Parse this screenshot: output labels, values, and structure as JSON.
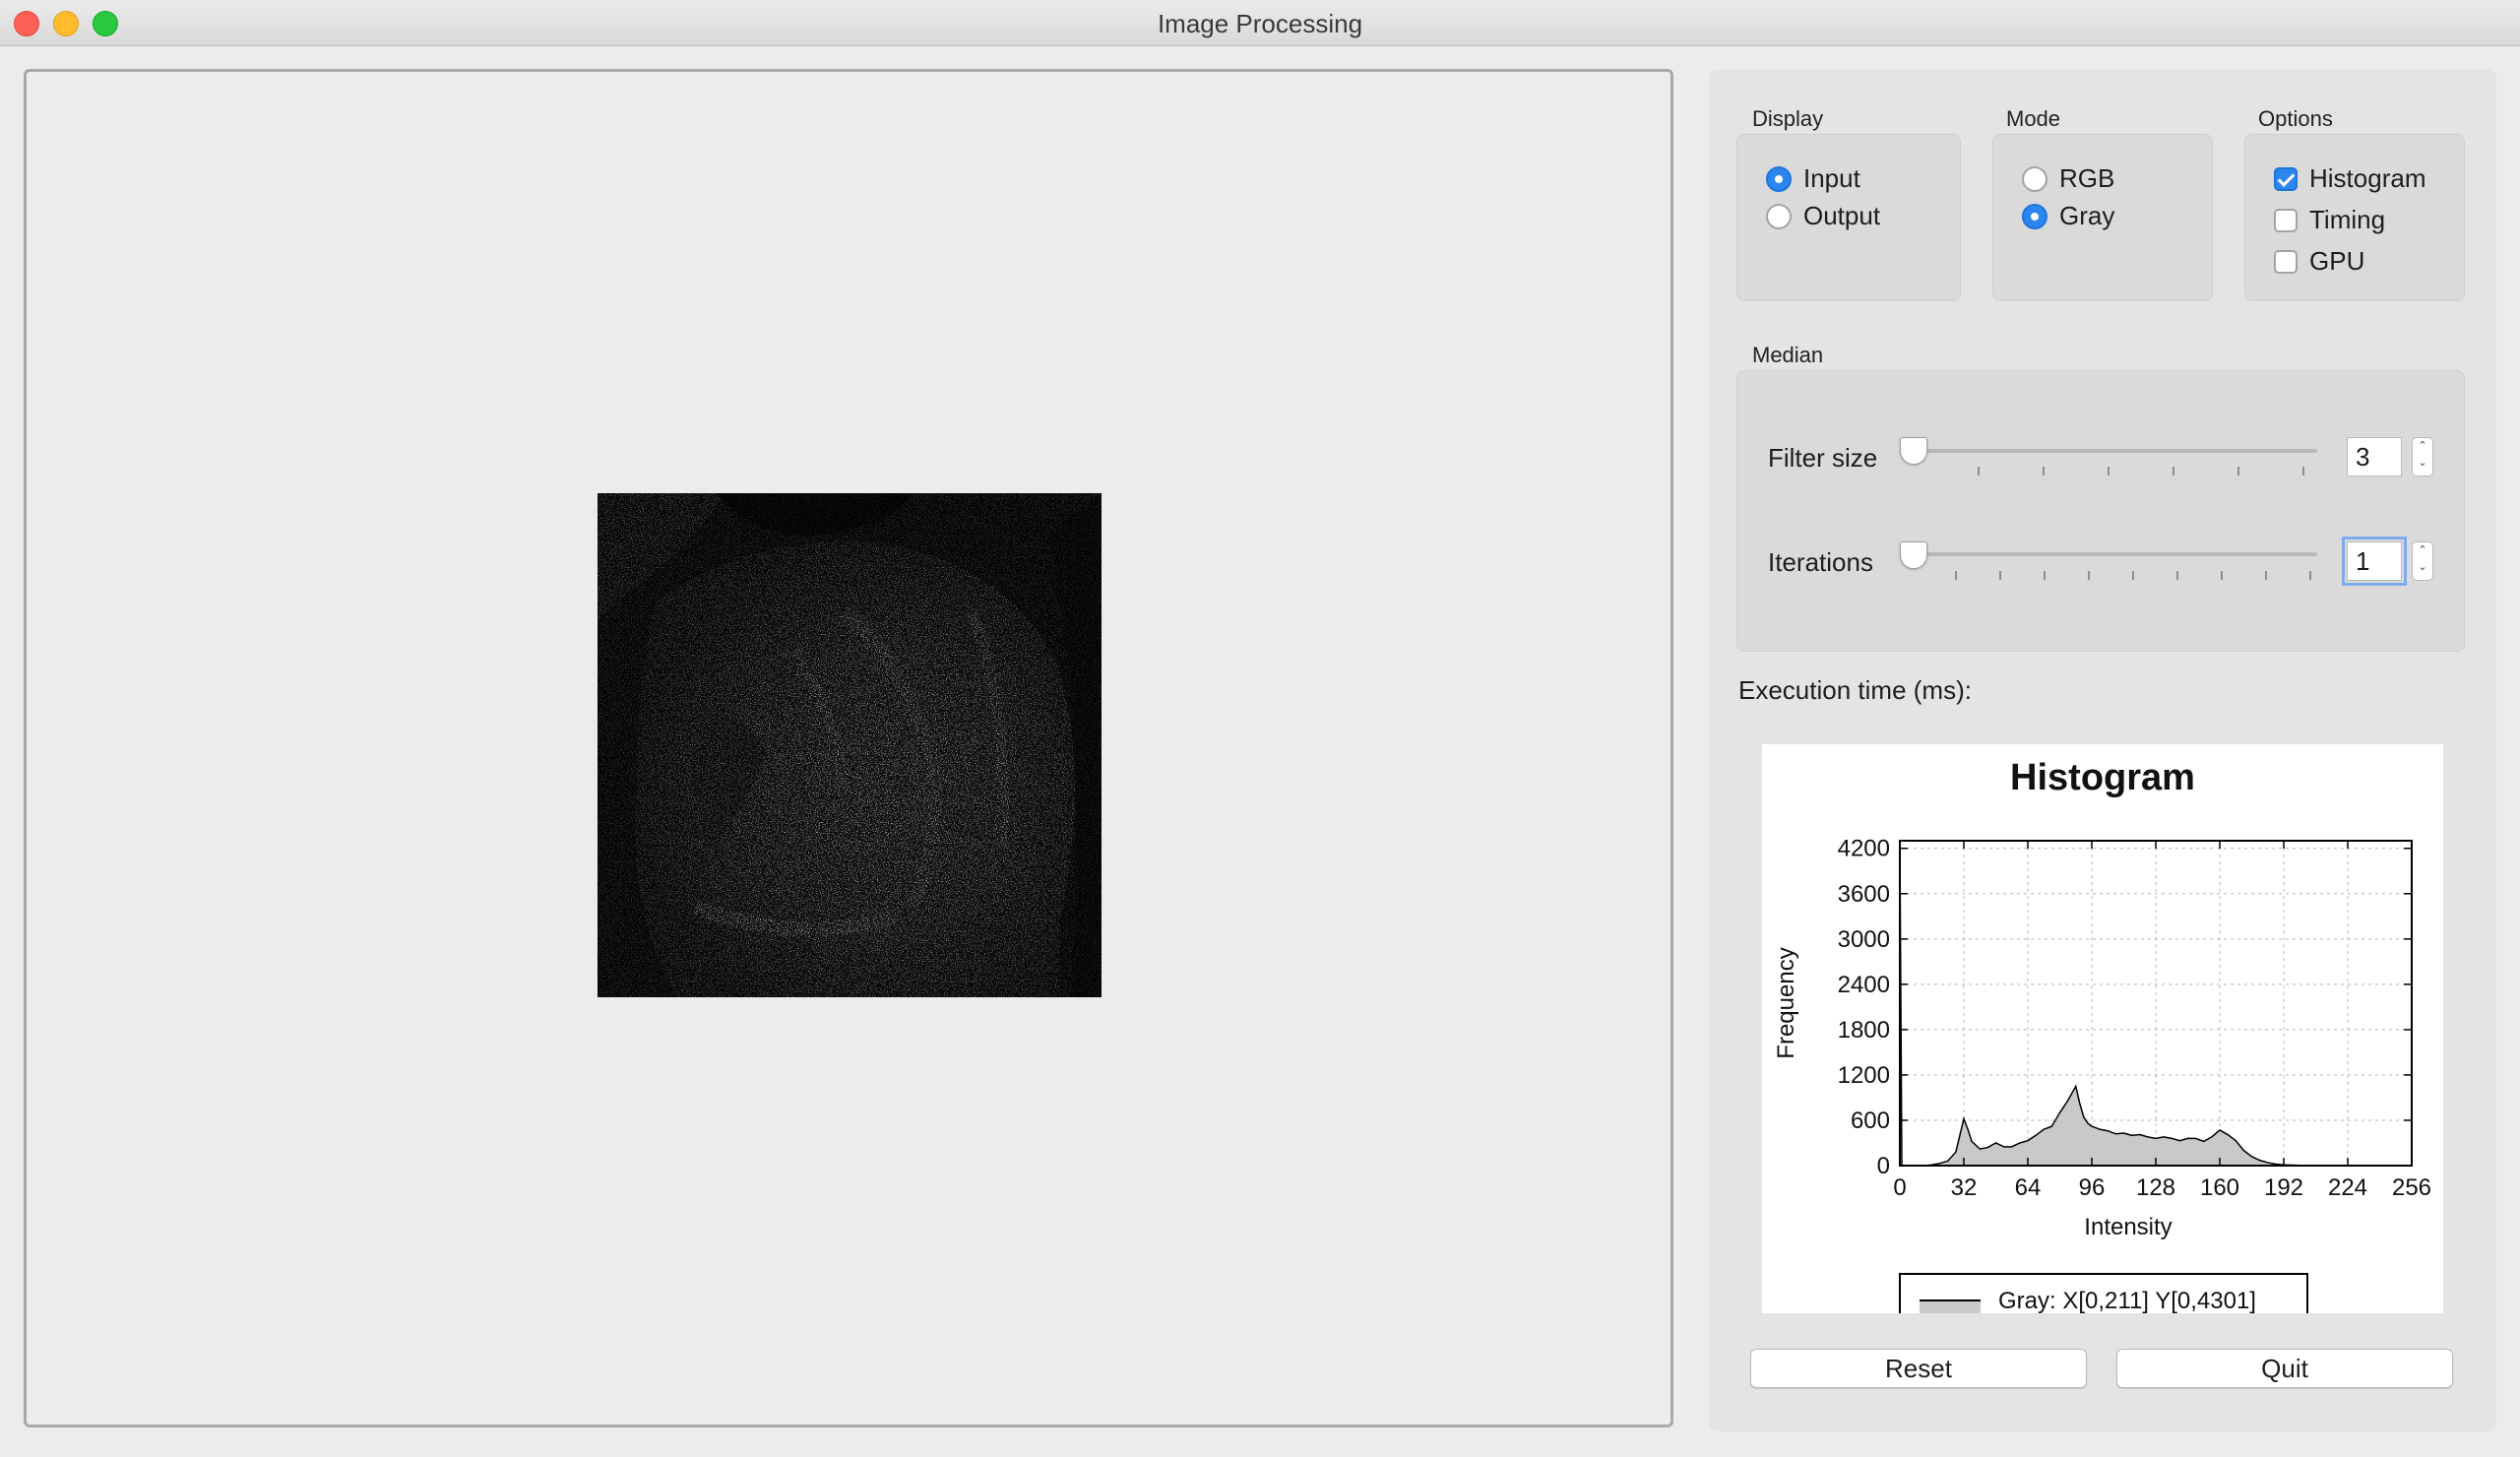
{
  "window": {
    "title": "Image Processing"
  },
  "display": {
    "title": "Display",
    "options": [
      {
        "label": "Input",
        "selected": true
      },
      {
        "label": "Output",
        "selected": false
      }
    ]
  },
  "mode": {
    "title": "Mode",
    "options": [
      {
        "label": "RGB",
        "selected": false
      },
      {
        "label": "Gray",
        "selected": true
      }
    ]
  },
  "options": {
    "title": "Options",
    "items": [
      {
        "label": "Histogram",
        "checked": true
      },
      {
        "label": "Timing",
        "checked": false
      },
      {
        "label": "GPU",
        "checked": false
      }
    ]
  },
  "median": {
    "title": "Median",
    "filter_size": {
      "label": "Filter size",
      "value": "3"
    },
    "iterations": {
      "label": "Iterations",
      "value": "1"
    }
  },
  "execution_time": {
    "label": "Execution time (ms):"
  },
  "buttons": {
    "reset": "Reset",
    "quit": "Quit"
  },
  "colors": {
    "accent": "#2d86f0",
    "panel": "#e4e4e4",
    "group": "#dadada",
    "fill": "#c9c9c9"
  },
  "chart_data": {
    "type": "area",
    "title": "Histogram",
    "xlabel": "Intensity",
    "ylabel": "Frequency",
    "xlim": [
      0,
      256
    ],
    "ylim": [
      0,
      4301
    ],
    "xticks": [
      0,
      32,
      64,
      96,
      128,
      160,
      192,
      224,
      256
    ],
    "yticks": [
      0,
      600,
      1200,
      1800,
      2400,
      3000,
      3600,
      4200
    ],
    "grid": true,
    "legend": {
      "placement": "bottom",
      "entry": "Gray: X[0,211] Y[0,4301]"
    },
    "series": [
      {
        "name": "Gray",
        "x": [
          0,
          1,
          2,
          4,
          6,
          8,
          12,
          16,
          20,
          24,
          28,
          30,
          32,
          34,
          36,
          40,
          44,
          48,
          52,
          56,
          60,
          64,
          68,
          72,
          76,
          80,
          84,
          88,
          90,
          92,
          94,
          96,
          100,
          104,
          108,
          112,
          116,
          120,
          124,
          128,
          132,
          136,
          140,
          144,
          148,
          152,
          156,
          160,
          164,
          168,
          172,
          176,
          180,
          184,
          188,
          192,
          196,
          200,
          204,
          208,
          211
        ],
        "y": [
          4301,
          0,
          0,
          0,
          0,
          0,
          0,
          10,
          30,
          60,
          180,
          400,
          620,
          480,
          320,
          220,
          240,
          300,
          250,
          250,
          300,
          330,
          400,
          480,
          520,
          700,
          860,
          1050,
          820,
          640,
          560,
          520,
          480,
          460,
          420,
          430,
          400,
          410,
          380,
          360,
          380,
          360,
          330,
          360,
          360,
          320,
          380,
          470,
          410,
          330,
          200,
          120,
          70,
          40,
          20,
          10,
          6,
          4,
          2,
          1,
          0
        ]
      }
    ]
  }
}
